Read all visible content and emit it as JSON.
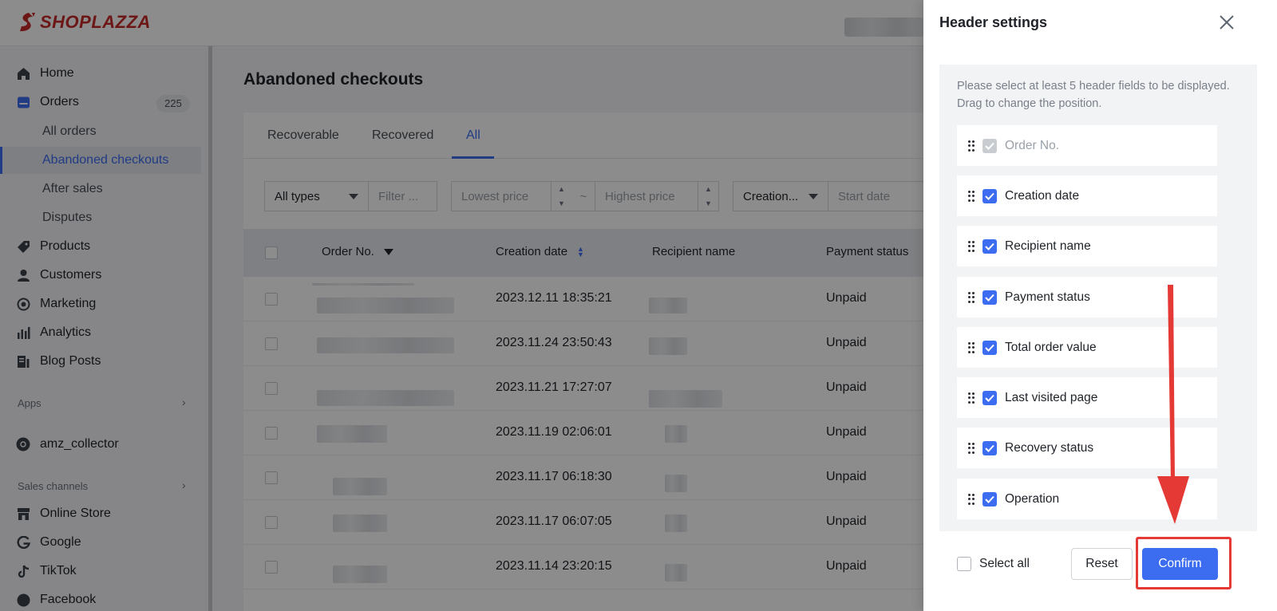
{
  "app": {
    "brand": "SHOPLAZZA",
    "brand_color": "#c62828",
    "accent_color": "#3c6cf0"
  },
  "sidebar": {
    "items": [
      {
        "label": "Home",
        "icon": "home-icon"
      },
      {
        "label": "Orders",
        "icon": "orders-icon",
        "badge": "225"
      },
      {
        "label": "Products",
        "icon": "tag-icon"
      },
      {
        "label": "Customers",
        "icon": "person-icon"
      },
      {
        "label": "Marketing",
        "icon": "marketing-icon"
      },
      {
        "label": "Analytics",
        "icon": "bar-chart-icon"
      },
      {
        "label": "Blog Posts",
        "icon": "blog-icon"
      }
    ],
    "order_subitems": [
      "All orders",
      "Abandoned checkouts",
      "After sales",
      "Disputes"
    ],
    "active": "Abandoned checkouts",
    "apps_section": "Apps",
    "app_items": [
      {
        "label": "amz_collector",
        "icon": "app-icon"
      }
    ],
    "sales_channels_section": "Sales channels",
    "channel_items": [
      {
        "label": "Online Store",
        "icon": "store-icon"
      },
      {
        "label": "Google",
        "icon": "google-icon"
      },
      {
        "label": "TikTok",
        "icon": "tiktok-icon"
      },
      {
        "label": "Facebook",
        "icon": "facebook-icon"
      }
    ]
  },
  "main": {
    "title": "Abandoned checkouts",
    "tabs": [
      "Recoverable",
      "Recovered",
      "All"
    ],
    "active_tab": "All",
    "filters": {
      "type_select": "All types",
      "filter_placeholder": "Filter ...",
      "lowest_price_placeholder": "Lowest price",
      "range_separator": "~",
      "highest_price_placeholder": "Highest price",
      "date_select": "Creation...",
      "start_date_placeholder": "Start date"
    },
    "table": {
      "columns": [
        "Order No.",
        "Creation date",
        "Recipient name",
        "Payment status"
      ],
      "rows": [
        {
          "creation_date": "2023.12.11 18:35:21",
          "payment_status": "Unpaid"
        },
        {
          "creation_date": "2023.11.24 23:50:43",
          "payment_status": "Unpaid"
        },
        {
          "creation_date": "2023.11.21 17:27:07",
          "payment_status": "Unpaid"
        },
        {
          "creation_date": "2023.11.19 02:06:01",
          "payment_status": "Unpaid"
        },
        {
          "creation_date": "2023.11.17 06:18:30",
          "payment_status": "Unpaid"
        },
        {
          "creation_date": "2023.11.17 06:07:05",
          "payment_status": "Unpaid"
        },
        {
          "creation_date": "2023.11.14 23:20:15",
          "payment_status": "Unpaid"
        }
      ]
    }
  },
  "panel": {
    "title": "Header settings",
    "description": "Please select at least 5 header fields to be displayed. Drag to change the position.",
    "fields": [
      {
        "label": "Order No.",
        "checked": true,
        "disabled": true
      },
      {
        "label": "Creation date",
        "checked": true,
        "disabled": false
      },
      {
        "label": "Recipient name",
        "checked": true,
        "disabled": false
      },
      {
        "label": "Payment status",
        "checked": true,
        "disabled": false
      },
      {
        "label": "Total order value",
        "checked": true,
        "disabled": false
      },
      {
        "label": "Last visited page",
        "checked": true,
        "disabled": false
      },
      {
        "label": "Recovery status",
        "checked": true,
        "disabled": false
      },
      {
        "label": "Operation",
        "checked": true,
        "disabled": false
      }
    ],
    "select_all_label": "Select all",
    "reset_label": "Reset",
    "confirm_label": "Confirm",
    "annotation_color": "#e53935"
  }
}
